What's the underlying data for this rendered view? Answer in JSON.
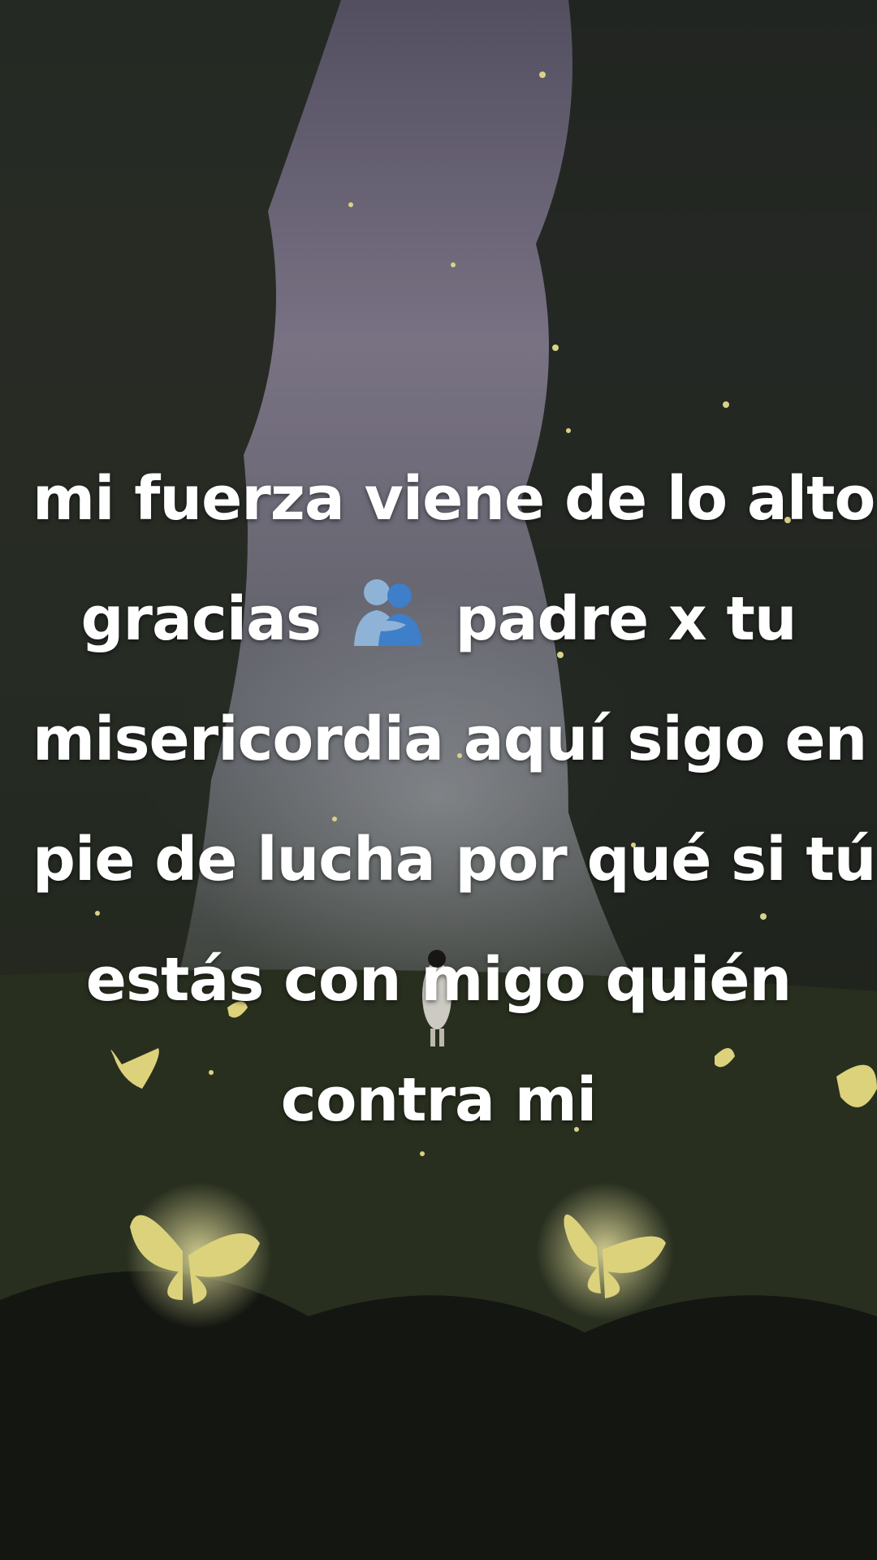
{
  "caption": {
    "line1": "mi fuerza viene de lo alto",
    "line2a": "gracias",
    "line2_icon": "people-hugging-icon",
    "line2b": "padre x tu",
    "line3": "misericordia aquí sigo en",
    "line4": "pie de lucha por qué si tú",
    "line5": "estás con migo quién",
    "line6": "contra mi"
  },
  "colors": {
    "caption_text": "#ffffff",
    "sky": "#8a8296",
    "forest_dark": "#1f241c",
    "firefly": "#f7ef9a"
  }
}
